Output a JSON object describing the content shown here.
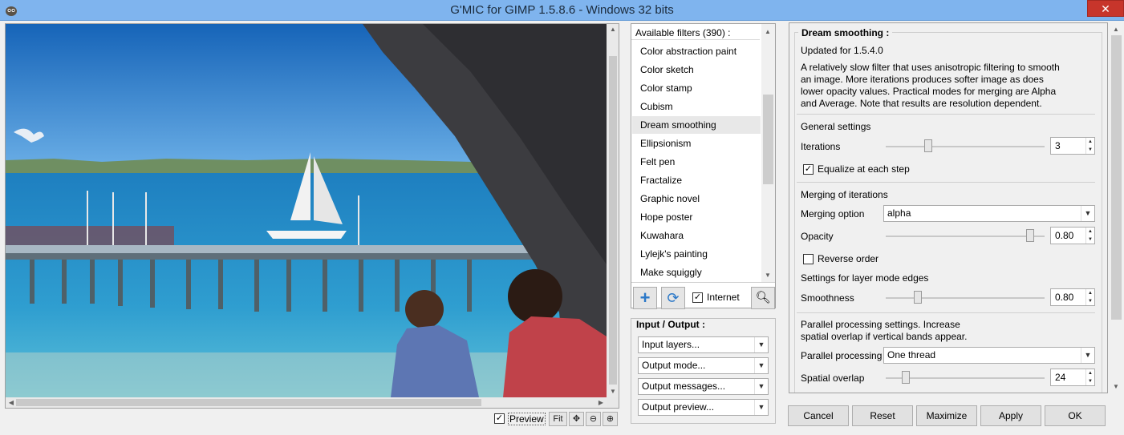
{
  "window": {
    "title": "G'MIC for GIMP 1.5.8.6 - Windows 32 bits",
    "close_icon": "✕"
  },
  "preview": {
    "preview_checked": true,
    "preview_label": "Preview",
    "fit_label": "Fit"
  },
  "filters": {
    "header": "Available filters (390) :",
    "items": [
      "Color abstraction paint",
      "Color sketch",
      "Color stamp",
      "Cubism",
      "Dream smoothing",
      "Ellipsionism",
      "Felt pen",
      "Fractalize",
      "Graphic novel",
      "Hope poster",
      "Kuwahara",
      "Lylejk's painting",
      "Make squiggly"
    ],
    "selected_index": 4,
    "internet_label": "Internet",
    "internet_checked": true
  },
  "io": {
    "title": "Input / Output :",
    "combos": [
      "Input layers...",
      "Output mode...",
      "Output messages...",
      "Output preview..."
    ]
  },
  "settings": {
    "title": "Dream smoothing :",
    "updated": "Updated for 1.5.4.0",
    "description": [
      "A relatively slow filter that uses anisotropic filtering to smooth",
      "an image. More iterations produces softer image as does",
      "lower opacity values. Practical modes for merging are Alpha",
      "and Average. Note that results are resolution dependent."
    ],
    "general_label": "General settings",
    "iterations_label": "Iterations",
    "iterations_value": "3",
    "equalize_label": "Equalize at each step",
    "equalize_checked": true,
    "merging_label": "Merging of iterations",
    "merging_option_label": "Merging option",
    "merging_option_value": "alpha",
    "opacity_label": "Opacity",
    "opacity_value": "0.80",
    "reverse_label": "Reverse order",
    "reverse_checked": false,
    "edges_label": "Settings for layer mode edges",
    "smoothness_label": "Smoothness",
    "smoothness_value": "0.80",
    "parallel_text": [
      "Parallel processing settings. Increase",
      "spatial overlap if vertical bands appear."
    ],
    "parallel_label": "Parallel processing",
    "parallel_value": "One thread",
    "overlap_label": "Spatial overlap",
    "overlap_value": "24"
  },
  "buttons": {
    "cancel": "Cancel",
    "reset": "Reset",
    "maximize": "Maximize",
    "apply": "Apply",
    "ok": "OK"
  },
  "icons": {
    "app": "gimp-icon",
    "add": "plus-icon",
    "refresh": "refresh-icon",
    "zoom": "zoom-icon",
    "move": "move-icon",
    "zoom_out": "zoom-out-icon",
    "zoom_in": "zoom-in-icon"
  }
}
